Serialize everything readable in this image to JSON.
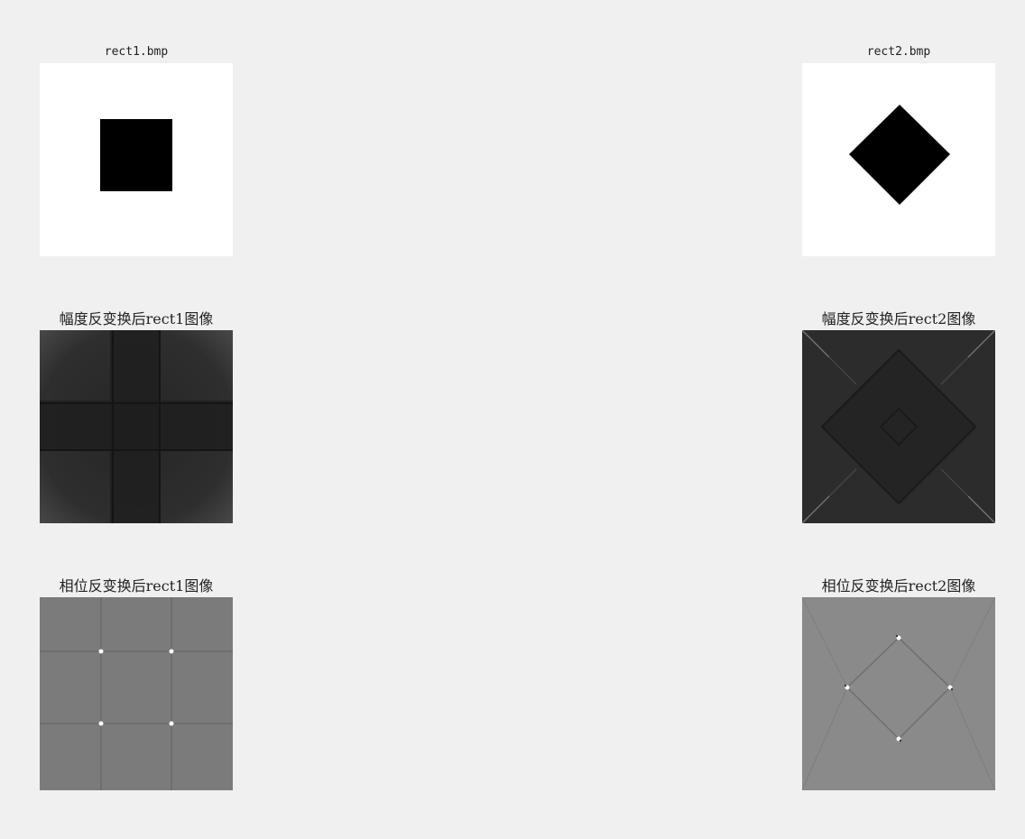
{
  "figure": {
    "background_color": "#f0f0f0",
    "panels": [
      {
        "title": "rect1.bmp",
        "kind": "source-square"
      },
      {
        "title": "rect2.bmp",
        "kind": "source-diamond"
      },
      {
        "title": "幅度反变换后rect1图像",
        "kind": "magnitude-square"
      },
      {
        "title": "幅度反变换后rect2图像",
        "kind": "magnitude-diamond"
      },
      {
        "title": "相位反变换后rect1图像",
        "kind": "phase-square"
      },
      {
        "title": "相位反变换后rect2图像",
        "kind": "phase-diamond"
      }
    ]
  }
}
